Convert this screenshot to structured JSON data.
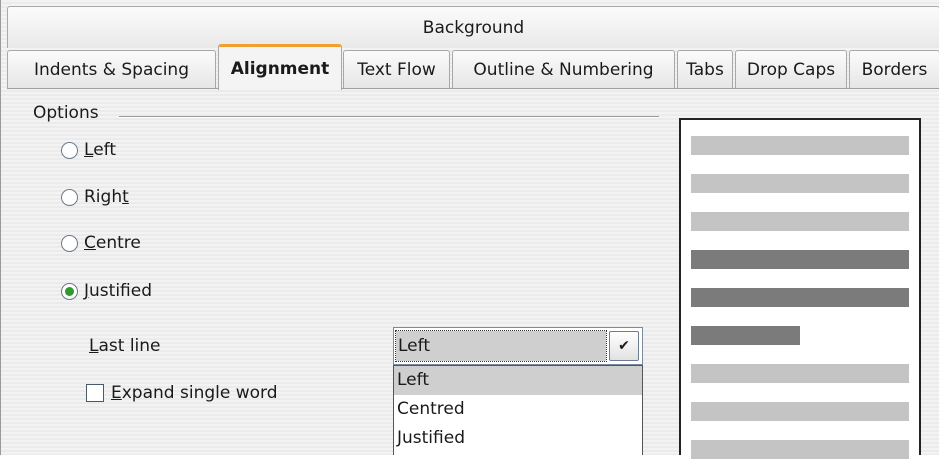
{
  "tabs_top": {
    "background": "Background"
  },
  "tabs": [
    {
      "label": "Indents & Spacing"
    },
    {
      "label": "Alignment"
    },
    {
      "label": "Text Flow"
    },
    {
      "label": "Outline & Numbering"
    },
    {
      "label": "Tabs"
    },
    {
      "label": "Drop Caps"
    },
    {
      "label": "Borders"
    }
  ],
  "active_tab": "Alignment",
  "options": {
    "legend": "Options",
    "radios": [
      {
        "prefix": "",
        "accel": "L",
        "rest": "eft",
        "checked": false
      },
      {
        "prefix": "Righ",
        "accel": "t",
        "rest": "",
        "checked": false
      },
      {
        "prefix": "",
        "accel": "C",
        "rest": "entre",
        "checked": false
      },
      {
        "prefix": "",
        "accel": "J",
        "rest": "ustified",
        "checked": true
      }
    ],
    "last_line": {
      "accel": "L",
      "rest": "ast line",
      "value": "Left"
    },
    "expand": {
      "accel": "E",
      "rest": "xpand single word",
      "checked": false
    }
  },
  "dropdown_options": [
    "Left",
    "Centred",
    "Justified"
  ],
  "preview": {
    "lines": [
      {
        "fill": 1.0,
        "shade": "light"
      },
      {
        "fill": 1.0,
        "shade": "light"
      },
      {
        "fill": 1.0,
        "shade": "light"
      },
      {
        "fill": 1.0,
        "shade": "dark"
      },
      {
        "fill": 1.0,
        "shade": "dark"
      },
      {
        "fill": 0.5,
        "shade": "dark"
      },
      {
        "fill": 1.0,
        "shade": "light"
      },
      {
        "fill": 1.0,
        "shade": "light"
      },
      {
        "fill": 1.0,
        "shade": "light"
      }
    ]
  },
  "colors": {
    "active_tab_accent": "#f0a030",
    "radio_checked": "#2e9a2e"
  }
}
